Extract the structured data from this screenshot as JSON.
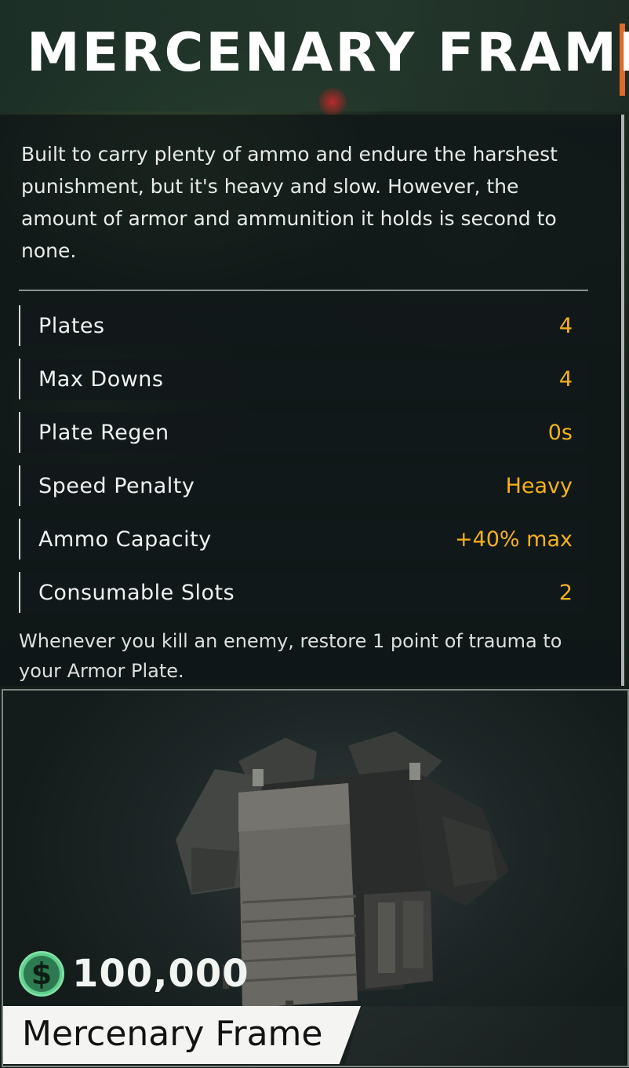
{
  "header": {
    "title": "MERCENARY FRAME"
  },
  "description": "Built to carry plenty of ammo and endure the harshest punishment, but it's heavy and slow. However, the amount of armor and ammunition it holds is second to none.",
  "stats": [
    {
      "label": "Plates",
      "value": "4"
    },
    {
      "label": "Max Downs",
      "value": "4"
    },
    {
      "label": "Plate Regen",
      "value": "0s"
    },
    {
      "label": "Speed Penalty",
      "value": "Heavy"
    },
    {
      "label": "Ammo Capacity",
      "value": "+40% max"
    },
    {
      "label": "Consumable Slots",
      "value": "2"
    }
  ],
  "perk_text": "Whenever you kill an enemy, restore 1 point of trauma to your Armor Plate.",
  "item": {
    "price_symbol": "$",
    "price": "100,000",
    "name": "Mercenary Frame",
    "image_icon": "armor-vest-icon"
  },
  "colors": {
    "accent": "#e06a2a",
    "stat_value": "#f5b21a",
    "currency": "#5fcf8d"
  }
}
